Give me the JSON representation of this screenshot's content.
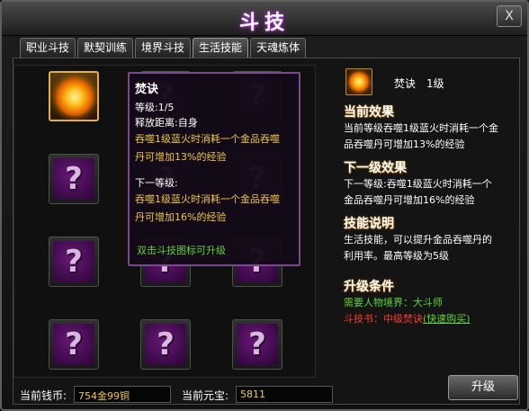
{
  "window": {
    "title": "斗技",
    "close_label": "X"
  },
  "tabs": [
    {
      "label": "职业斗技"
    },
    {
      "label": "默契训练"
    },
    {
      "label": "境界斗技"
    },
    {
      "label": "生活技能"
    },
    {
      "label": "天魂炼体"
    }
  ],
  "active_tab": "生活技能",
  "slots": {
    "locked_symbol": "?"
  },
  "tooltip": {
    "name": "焚诀",
    "level_line": "等级:1/5",
    "range_line": "释放距离:自身",
    "desc_line1": "吞噬1级蓝火时消耗一个金品吞噬",
    "desc_line2": "丹可增加13%的经验",
    "next_label": "下一等级:",
    "next_line1": "吞噬1级蓝火时消耗一个金品吞噬",
    "next_line2": "丹可增加16%的经验",
    "hint": "双击斗技图标可升级"
  },
  "info": {
    "skill_name": "焚诀",
    "skill_level": "1级",
    "current_title": "当前效果",
    "current_line1": "当前等级吞噬1级蓝火时消耗一个金",
    "current_line2": "品吞噬丹可增加13%的经验",
    "next_title": "下一级效果",
    "next_line1": "下一等级:吞噬1级蓝火时消耗一个",
    "next_line2": "金品吞噬丹可增加16%的经验",
    "desc_title": "技能说明",
    "desc_line1": "生活技能，可以提升金品吞噬丹的",
    "desc_line2": "利用率。最高等级为5级",
    "cond_title": "升级条件",
    "cond_realm_label": "需要人物境界：",
    "cond_realm_value": "大斗师",
    "cond_book_label": "斗技书：",
    "cond_book_value": "中级焚诀",
    "cond_buy_link": "(快速购买)"
  },
  "footer": {
    "money_label": "当前钱币:",
    "money_value": "754金99铜",
    "yuanbao_label": "当前元宝:",
    "yuanbao_value": "5811",
    "upgrade_label": "升级"
  },
  "colors": {
    "accent": "#f0c84a",
    "green": "#5fd43a",
    "red": "#ff3a2a"
  }
}
